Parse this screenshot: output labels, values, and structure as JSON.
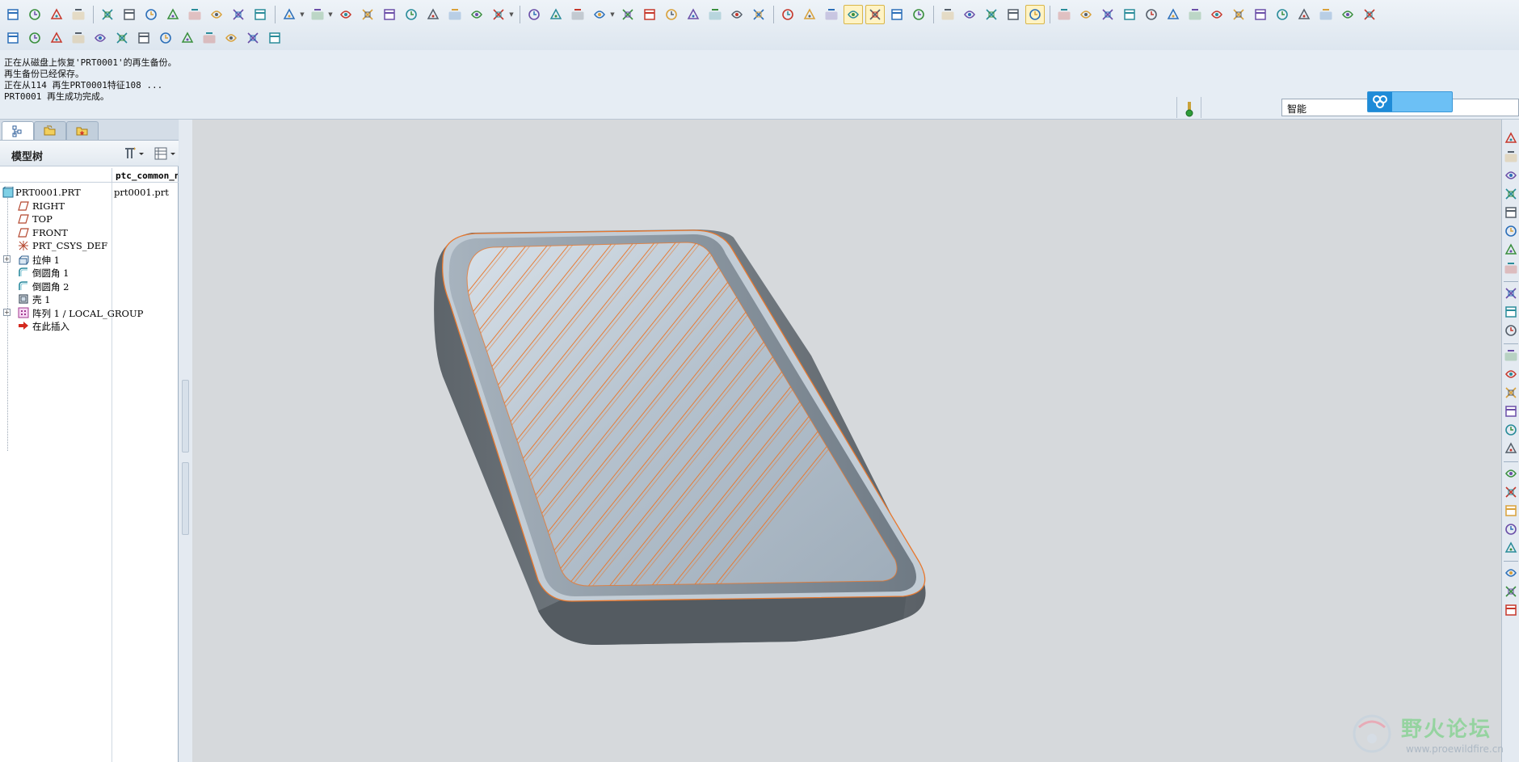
{
  "toolbar": {
    "row1": [
      {
        "name": "window-icon"
      },
      {
        "name": "new-window-icon"
      },
      {
        "name": "close-window-icon"
      },
      {
        "name": "edit-icon"
      },
      {
        "sep": true
      },
      {
        "name": "open-session-icon"
      },
      {
        "name": "new-file-icon"
      },
      {
        "name": "open-file-icon"
      },
      {
        "name": "save-icon"
      },
      {
        "name": "save-copy-icon"
      },
      {
        "name": "print-icon"
      },
      {
        "name": "print-preview-icon"
      },
      {
        "name": "email-icon"
      },
      {
        "sep": true
      },
      {
        "name": "undo-icon",
        "drop": true
      },
      {
        "name": "redo-icon",
        "drop": true
      },
      {
        "name": "cut-icon"
      },
      {
        "name": "copy-icon"
      },
      {
        "name": "paste-icon"
      },
      {
        "name": "paste-special-icon"
      },
      {
        "name": "regenerate-icon"
      },
      {
        "name": "regen-manager-icon"
      },
      {
        "name": "find-icon"
      },
      {
        "name": "select-box-icon",
        "drop": true
      },
      {
        "sep": true
      },
      {
        "name": "repaint-icon"
      },
      {
        "name": "spin-center-icon"
      },
      {
        "name": "orient-icon"
      },
      {
        "name": "appearance-icon",
        "drop": true
      },
      {
        "name": "zoom-in-icon"
      },
      {
        "name": "zoom-out-icon"
      },
      {
        "name": "refit-icon"
      },
      {
        "name": "reorient-icon"
      },
      {
        "name": "saved-views-icon"
      },
      {
        "name": "layers-icon"
      },
      {
        "name": "view-manager-icon"
      },
      {
        "sep": true
      },
      {
        "name": "wireframe-icon"
      },
      {
        "name": "hidden-line-icon"
      },
      {
        "name": "no-hidden-icon"
      },
      {
        "name": "shading-icon",
        "active": true
      },
      {
        "name": "tolerance-icon",
        "active": true
      },
      {
        "name": "slider-icon"
      },
      {
        "name": "render-icon"
      },
      {
        "sep": true
      },
      {
        "name": "datum-plane-display-icon"
      },
      {
        "name": "datum-axis-display-icon"
      },
      {
        "name": "datum-point-display-icon"
      },
      {
        "name": "csys-display-icon"
      },
      {
        "name": "annotation-display-icon",
        "active": true
      },
      {
        "sep": true
      },
      {
        "name": "analysis-measure-icon"
      },
      {
        "name": "analysis-mass-icon"
      },
      {
        "name": "analysis-section-icon"
      },
      {
        "name": "table-icon"
      },
      {
        "name": "relations-icon"
      },
      {
        "name": "parameters-icon"
      },
      {
        "name": "curvature-icon"
      },
      {
        "name": "surface-analysis-icon"
      },
      {
        "name": "graph-icon"
      },
      {
        "name": "color-wheel-icon"
      },
      {
        "name": "draft-analysis-icon"
      },
      {
        "name": "reflection-icon"
      },
      {
        "name": "deviation-icon"
      },
      {
        "name": "sketch-hide-icon"
      },
      {
        "name": "visibility-icon"
      }
    ],
    "row2": [
      {
        "name": "sketch-tool-icon"
      },
      {
        "name": "dim-tool-icon"
      },
      {
        "name": "dim-tool2-icon"
      },
      {
        "name": "pencil-icon"
      },
      {
        "name": "align-icon"
      },
      {
        "name": "align2-icon"
      },
      {
        "name": "pattern-icon"
      },
      {
        "name": "grid-icon"
      },
      {
        "name": "family-table-icon"
      },
      {
        "name": "tree-icon"
      },
      {
        "name": "folder-open-icon"
      },
      {
        "name": "drawing-icon"
      },
      {
        "name": "publish-icon"
      }
    ]
  },
  "messages": [
    "正在从磁盘上恢复'PRT0001'的再生备份。",
    "再生备份已经保存。",
    "正在从114 再生PRT0001特征108 ...",
    "PRT0001 再生成功完成。"
  ],
  "filter": {
    "value": "智能"
  },
  "panel": {
    "tabs": [
      {
        "name": "model-tree-tab"
      },
      {
        "name": "folder-browser-tab"
      },
      {
        "name": "favorites-tab"
      }
    ],
    "title": "模型树",
    "column_header": "ptc_common_name",
    "rows": [
      {
        "label": "PRT0001.PRT",
        "col2": "prt0001.prt",
        "icon": "part-icon",
        "indent": 0,
        "expand": false
      },
      {
        "label": "RIGHT",
        "col2": "",
        "icon": "datum-plane-icon",
        "indent": 1,
        "expand": false
      },
      {
        "label": "TOP",
        "col2": "",
        "icon": "datum-plane-icon",
        "indent": 1,
        "expand": false
      },
      {
        "label": "FRONT",
        "col2": "",
        "icon": "datum-plane-icon",
        "indent": 1,
        "expand": false
      },
      {
        "label": "PRT_CSYS_DEF",
        "col2": "",
        "icon": "csys-icon",
        "indent": 1,
        "expand": false
      },
      {
        "label": "拉伸 1",
        "col2": "",
        "icon": "extrude-icon",
        "indent": 1,
        "expand": true
      },
      {
        "label": "倒圆角 1",
        "col2": "",
        "icon": "round-icon",
        "indent": 1,
        "expand": false
      },
      {
        "label": "倒圆角 2",
        "col2": "",
        "icon": "round-icon",
        "indent": 1,
        "expand": false
      },
      {
        "label": "壳 1",
        "col2": "",
        "icon": "shell-icon",
        "indent": 1,
        "expand": false
      },
      {
        "label": "阵列 1 / LOCAL_GROUP",
        "col2": "",
        "icon": "pattern-feature-icon",
        "indent": 1,
        "expand": true
      },
      {
        "label": "在此插入",
        "col2": "",
        "icon": "insert-arrow-icon",
        "indent": 1,
        "expand": false
      }
    ]
  },
  "watermark": {
    "text": "野火论坛",
    "url": "www.proewildfire.cn"
  },
  "colors": {
    "edge_highlight": "#e8782e",
    "tray_wall": "#6b7278",
    "tray_floor": "#b8c4cf",
    "background": "#d6d9dc"
  }
}
